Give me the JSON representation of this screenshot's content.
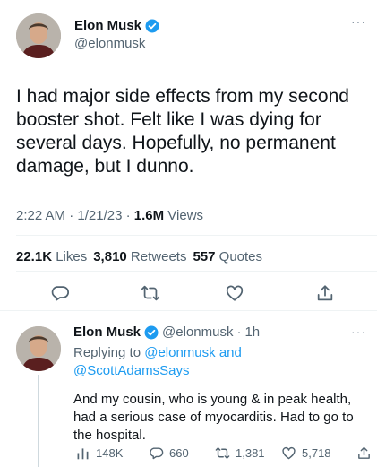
{
  "main_tweet": {
    "author_name": "Elon Musk",
    "author_handle": "@elonmusk",
    "text": "I had major side effects from my second booster shot. Felt like I was dying for several days. Hopefully, no permanent damage, but I dunno.",
    "time": "2:22 AM",
    "sep1": " · ",
    "date": "1/21/23",
    "sep2": " · ",
    "views_count": "1.6M",
    "views_label": " Views",
    "likes_count": "22.1K",
    "likes_label": " Likes",
    "retweets_count": "3,810",
    "retweets_label": " Retweets",
    "quotes_count": "557",
    "quotes_label": " Quotes",
    "more_label": "···"
  },
  "reply_tweet": {
    "author_name": "Elon Musk",
    "author_handle": "@elonmusk",
    "time_sep": " · ",
    "time": "1h",
    "replying_to_label": "Replying to ",
    "replying_to_user1": "@elonmusk",
    "replying_to_and": " and",
    "replying_to_user2": "@ScottAdamsSays",
    "text": "And my cousin, who is young & in peak health, had a serious case of myocarditis. Had to go to the hospital.",
    "views": "148K",
    "replies": "660",
    "retweets": "1,381",
    "likes": "5,718",
    "more_label": "···"
  },
  "colors": {
    "accent": "#1d9bf0",
    "text": "#0f1419",
    "secondary": "#536471",
    "divider": "#eff3f4"
  }
}
